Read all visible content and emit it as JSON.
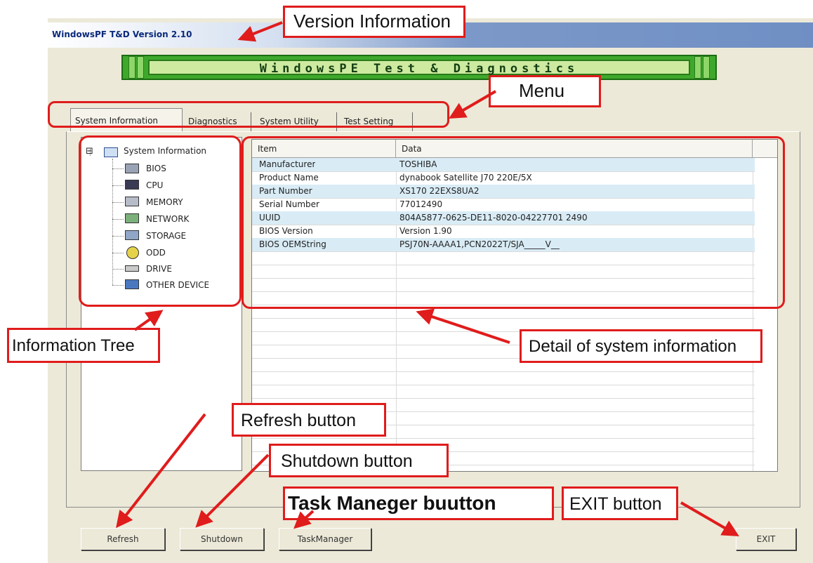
{
  "window": {
    "title": "WindowsPF T&D Version 2.10",
    "banner_text": "WindowsPE Test & Diagnostics"
  },
  "tabs": [
    {
      "label": "System Information",
      "active": true
    },
    {
      "label": "Diagnostics",
      "active": false
    },
    {
      "label": "System Utility",
      "active": false
    },
    {
      "label": "Test Setting",
      "active": false
    }
  ],
  "tree": {
    "expander": "⊟",
    "root": "System Information",
    "children": [
      "BIOS",
      "CPU",
      "MEMORY",
      "NETWORK",
      "STORAGE",
      "ODD",
      "DRIVE",
      "OTHER DEVICE"
    ]
  },
  "grid": {
    "headers": [
      "Item",
      "Data"
    ],
    "rows": [
      {
        "item": "Manufacturer",
        "data": "TOSHIBA"
      },
      {
        "item": "Product Name",
        "data": "dynabook Satellite J70 220E/5X"
      },
      {
        "item": "Part Number",
        "data": "XS170 22EXS8UA2"
      },
      {
        "item": "Serial Number",
        "data": "77012490"
      },
      {
        "item": "UUID",
        "data": "804A5877-0625-DE11-8020-04227701 2490"
      },
      {
        "item": "BIOS Version",
        "data": "Version 1.90"
      },
      {
        "item": "BIOS OEMString",
        "data": "PSJ70N-AAAA1,PCN2022T/SJA_____V__"
      }
    ]
  },
  "buttons": {
    "refresh": "Refresh",
    "shutdown": "Shutdown",
    "taskmanager": "TaskManager",
    "exit": "EXIT"
  },
  "annotations": {
    "version": "Version Information",
    "menu": "Menu",
    "tree": "Information Tree",
    "detail": "Detail of system information",
    "refresh": "Refresh button",
    "shutdown": "Shutdown button",
    "taskmanager": "Task Maneger buutton",
    "exit": "EXIT button",
    "color": "#e01c1c"
  }
}
